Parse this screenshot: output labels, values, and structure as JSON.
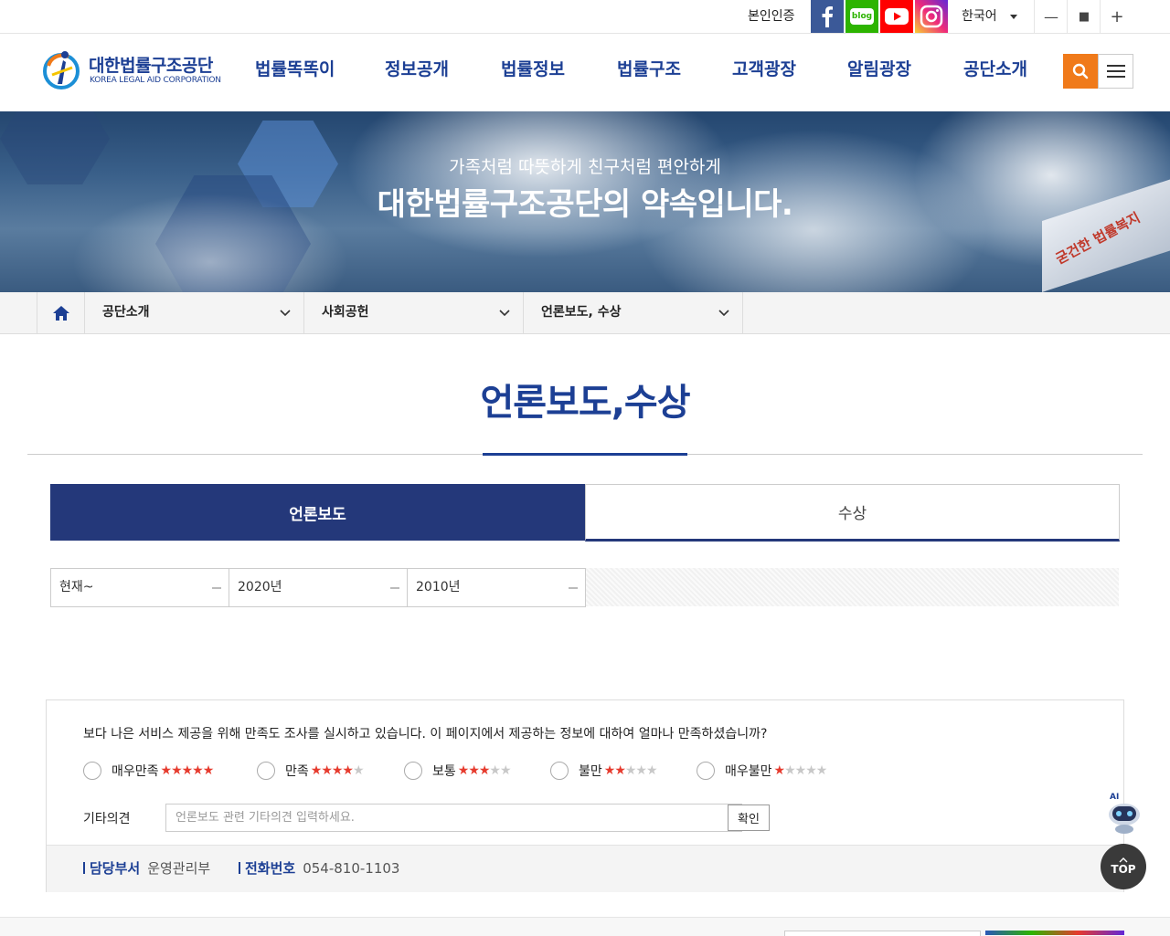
{
  "topbar": {
    "auth_label": "본인인증",
    "sns": [
      {
        "name": "facebook-icon",
        "color": "#3b5998"
      },
      {
        "name": "blog-icon",
        "label": "blog",
        "color": "#2db400"
      },
      {
        "name": "youtube-icon",
        "color": "#ff0000"
      },
      {
        "name": "instagram-icon",
        "color": "#ee2a7b"
      }
    ],
    "language": "한국어",
    "window_controls": [
      "—",
      "■",
      "+"
    ]
  },
  "header": {
    "logo_ko": "대한법률구조공단",
    "logo_en": "KOREA LEGAL AID CORPORATION",
    "nav": [
      "법률똑똑이",
      "정보공개",
      "법률정보",
      "법률구조",
      "고객광장",
      "알림광장",
      "공단소개"
    ],
    "accent_color": "#f07a1a",
    "brand_color": "#1c3f94"
  },
  "banner": {
    "subtitle": "가족처럼 따뜻하게 친구처럼 편안하게",
    "title": "대한법률구조공단의 약속입니다.",
    "sign_text": "굳건한 법률복지"
  },
  "breadcrumb": [
    "공단소개",
    "사회공헌",
    "언론보도, 수상"
  ],
  "page": {
    "title": "언론보도,수상",
    "tabs": [
      {
        "label": "언론보도",
        "active": true
      },
      {
        "label": "수상",
        "active": false
      }
    ],
    "years": [
      "현재~",
      "2020년",
      "2010년"
    ]
  },
  "survey": {
    "question": "보다 나은 서비스 제공을 위해 만족도 조사를 실시하고 있습니다. 이 페이지에서 제공하는 정보에 대하여 얼마나 만족하셨습니까?",
    "options": [
      {
        "label": "매우만족",
        "stars": 5
      },
      {
        "label": "만족",
        "stars": 4
      },
      {
        "label": "보통",
        "stars": 3
      },
      {
        "label": "불만",
        "stars": 2
      },
      {
        "label": "매우불만",
        "stars": 1
      }
    ],
    "etc_label": "기타의견",
    "etc_placeholder": "언론보도 관련 기타의견 입력하세요.",
    "confirm_label": "확인",
    "dept_key": "담당부서",
    "dept_value": "운영관리부",
    "phone_key": "전화번호",
    "phone_value": "054-810-1103"
  },
  "floating": {
    "ai_label": "AI",
    "top_label": "TOP"
  }
}
